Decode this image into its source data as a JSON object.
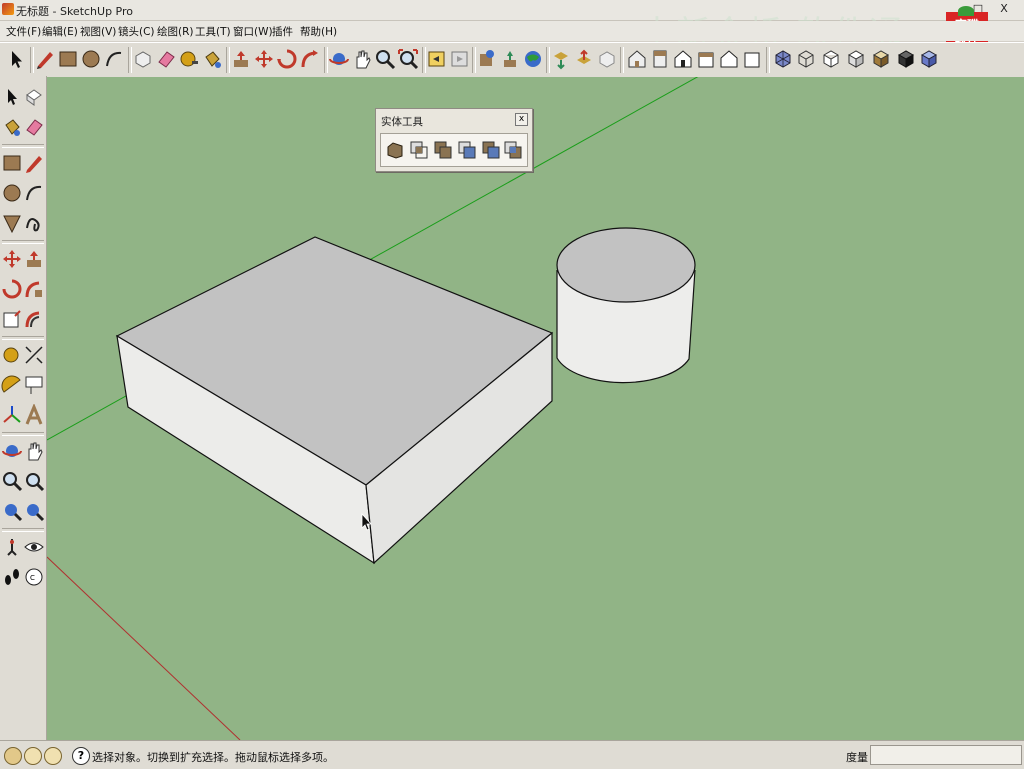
{
  "window": {
    "title": "无标题 - SketchUp Pro",
    "controls": {
      "minimize": "_",
      "maximize": "□",
      "close": "X"
    }
  },
  "menu": {
    "items": [
      "文件(F)",
      "编辑(E)",
      "视图(V)",
      "镜头(C)",
      "绘图(R)",
      "工具(T)",
      "窗口(W)",
      "插件",
      "帮助(H)"
    ]
  },
  "toolbar": {
    "icons": [
      "select-icon",
      "pencil-icon",
      "rectangle-icon",
      "circle-icon",
      "arc-icon",
      "make-component-icon",
      "eraser-icon",
      "tape-measure-icon",
      "paint-bucket-icon",
      "push-pull-icon",
      "move-icon",
      "rotate-icon",
      "follow-me-icon",
      "orbit-icon",
      "pan-icon",
      "zoom-icon",
      "zoom-extents-icon",
      "previous-view-icon",
      "next-view-icon",
      "add-location-icon",
      "google-earth-icon",
      "photo-textures-icon",
      "get-models-icon",
      "share-model-icon",
      "share-component-icon",
      "iso-view-icon",
      "top-view-icon",
      "front-view-icon",
      "right-view-icon",
      "back-view-icon",
      "left-view-icon",
      "xray-icon",
      "wireframe-icon",
      "hidden-line-icon",
      "shaded-icon",
      "shaded-texture-icon",
      "monochrome-icon"
    ]
  },
  "solid_tools_panel": {
    "title": "实体工具",
    "close": "x",
    "icons": [
      "outer-shell-icon",
      "intersect-icon",
      "union-icon",
      "subtract-icon",
      "trim-icon",
      "split-icon"
    ]
  },
  "status": {
    "message": "选择对象。切换到扩充选择。拖动鼠标选择多项。",
    "measure_label": "度量",
    "measure_value": ""
  },
  "watermark": "中新金桥 软件通",
  "logo": {
    "line1": "育碟",
    "line2": "软件"
  },
  "colors": {
    "viewport_bg": "#91b486",
    "face_top": "#c2c2c2",
    "face_side": "#ececea",
    "axis_green": "#1a9e1a",
    "axis_red": "#b03030"
  }
}
